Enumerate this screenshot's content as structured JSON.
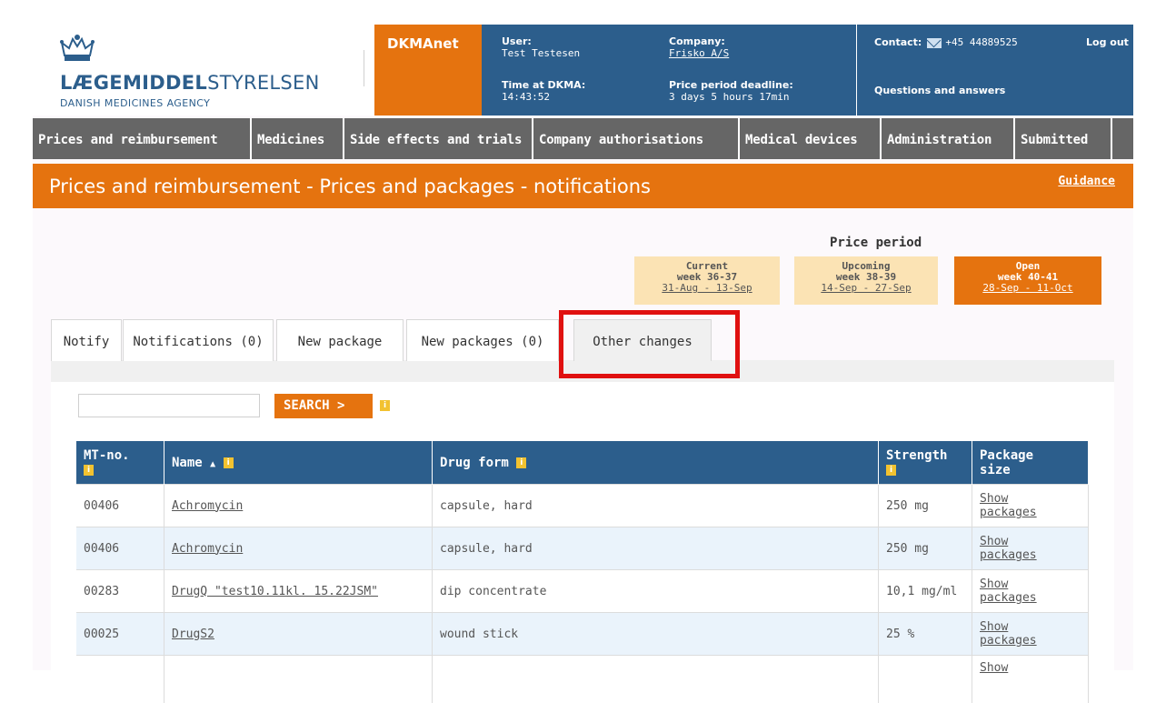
{
  "header": {
    "logo_main_bold": "LÆGEMIDDEL",
    "logo_main_rest": "STYRELSEN",
    "logo_sub": "DANISH MEDICINES AGENCY",
    "dkma": "DKMAnet",
    "user_label": "User:",
    "user_value": "Test Testesen",
    "company_label": "Company:",
    "company_value": "Frisko A/S",
    "time_label": "Time at DKMA:",
    "time_value": "14:43:52",
    "deadline_label": "Price period deadline:",
    "deadline_value": "3 days 5 hours 17min",
    "contact_label": "Contact:",
    "contact_phone": "+45 44889525",
    "logout": "Log out",
    "qa": "Questions and answers"
  },
  "nav": [
    "Prices and reimbursement",
    "Medicines",
    "Side effects and trials",
    "Company authorisations",
    "Medical devices",
    "Administration",
    "Submitted"
  ],
  "titlebar": {
    "title": "Prices and reimbursement - Prices and packages - notifications",
    "guidance": "Guidance"
  },
  "price_period": {
    "title": "Price period",
    "boxes": [
      {
        "label": "Current",
        "week": "week 36-37",
        "dates": "31-Aug - 13-Sep"
      },
      {
        "label": "Upcoming",
        "week": "week 38-39",
        "dates": "14-Sep - 27-Sep"
      },
      {
        "label": "Open",
        "week": "week 40-41",
        "dates": "28-Sep - 11-Oct"
      }
    ]
  },
  "tabs": [
    "Notify",
    "Notifications (0)",
    "New package",
    "New packages (0)",
    "Other changes"
  ],
  "search": {
    "value": "",
    "button": "SEARCH  >"
  },
  "table": {
    "headers": {
      "mt": "MT-no.",
      "name": "Name",
      "form": "Drug form",
      "strength": "Strength",
      "package_line1": "Package",
      "package_line2": "size"
    },
    "rows": [
      {
        "mt": "00406",
        "name": "Achromycin",
        "form": "capsule, hard",
        "strength": "250 mg",
        "show1": "Show",
        "show2": "packages"
      },
      {
        "mt": "00406",
        "name": "Achromycin",
        "form": "capsule, hard",
        "strength": "250 mg",
        "show1": "Show",
        "show2": "packages"
      },
      {
        "mt": "00283",
        "name": "DrugQ \"test10.11kl. 15.22JSM\"",
        "form": "dip concentrate",
        "strength": "10,1 mg/ml",
        "show1": "Show",
        "show2": "packages"
      },
      {
        "mt": "00025",
        "name": "DrugS2",
        "form": "wound stick",
        "strength": "25 %",
        "show1": "Show",
        "show2": "packages"
      },
      {
        "mt": "",
        "name": "",
        "form": "",
        "strength": "",
        "show1": "Show",
        "show2": ""
      }
    ]
  },
  "colors": {
    "brand_blue": "#2c5e8c",
    "brand_orange": "#e5730f",
    "highlight_red": "#e01010"
  }
}
